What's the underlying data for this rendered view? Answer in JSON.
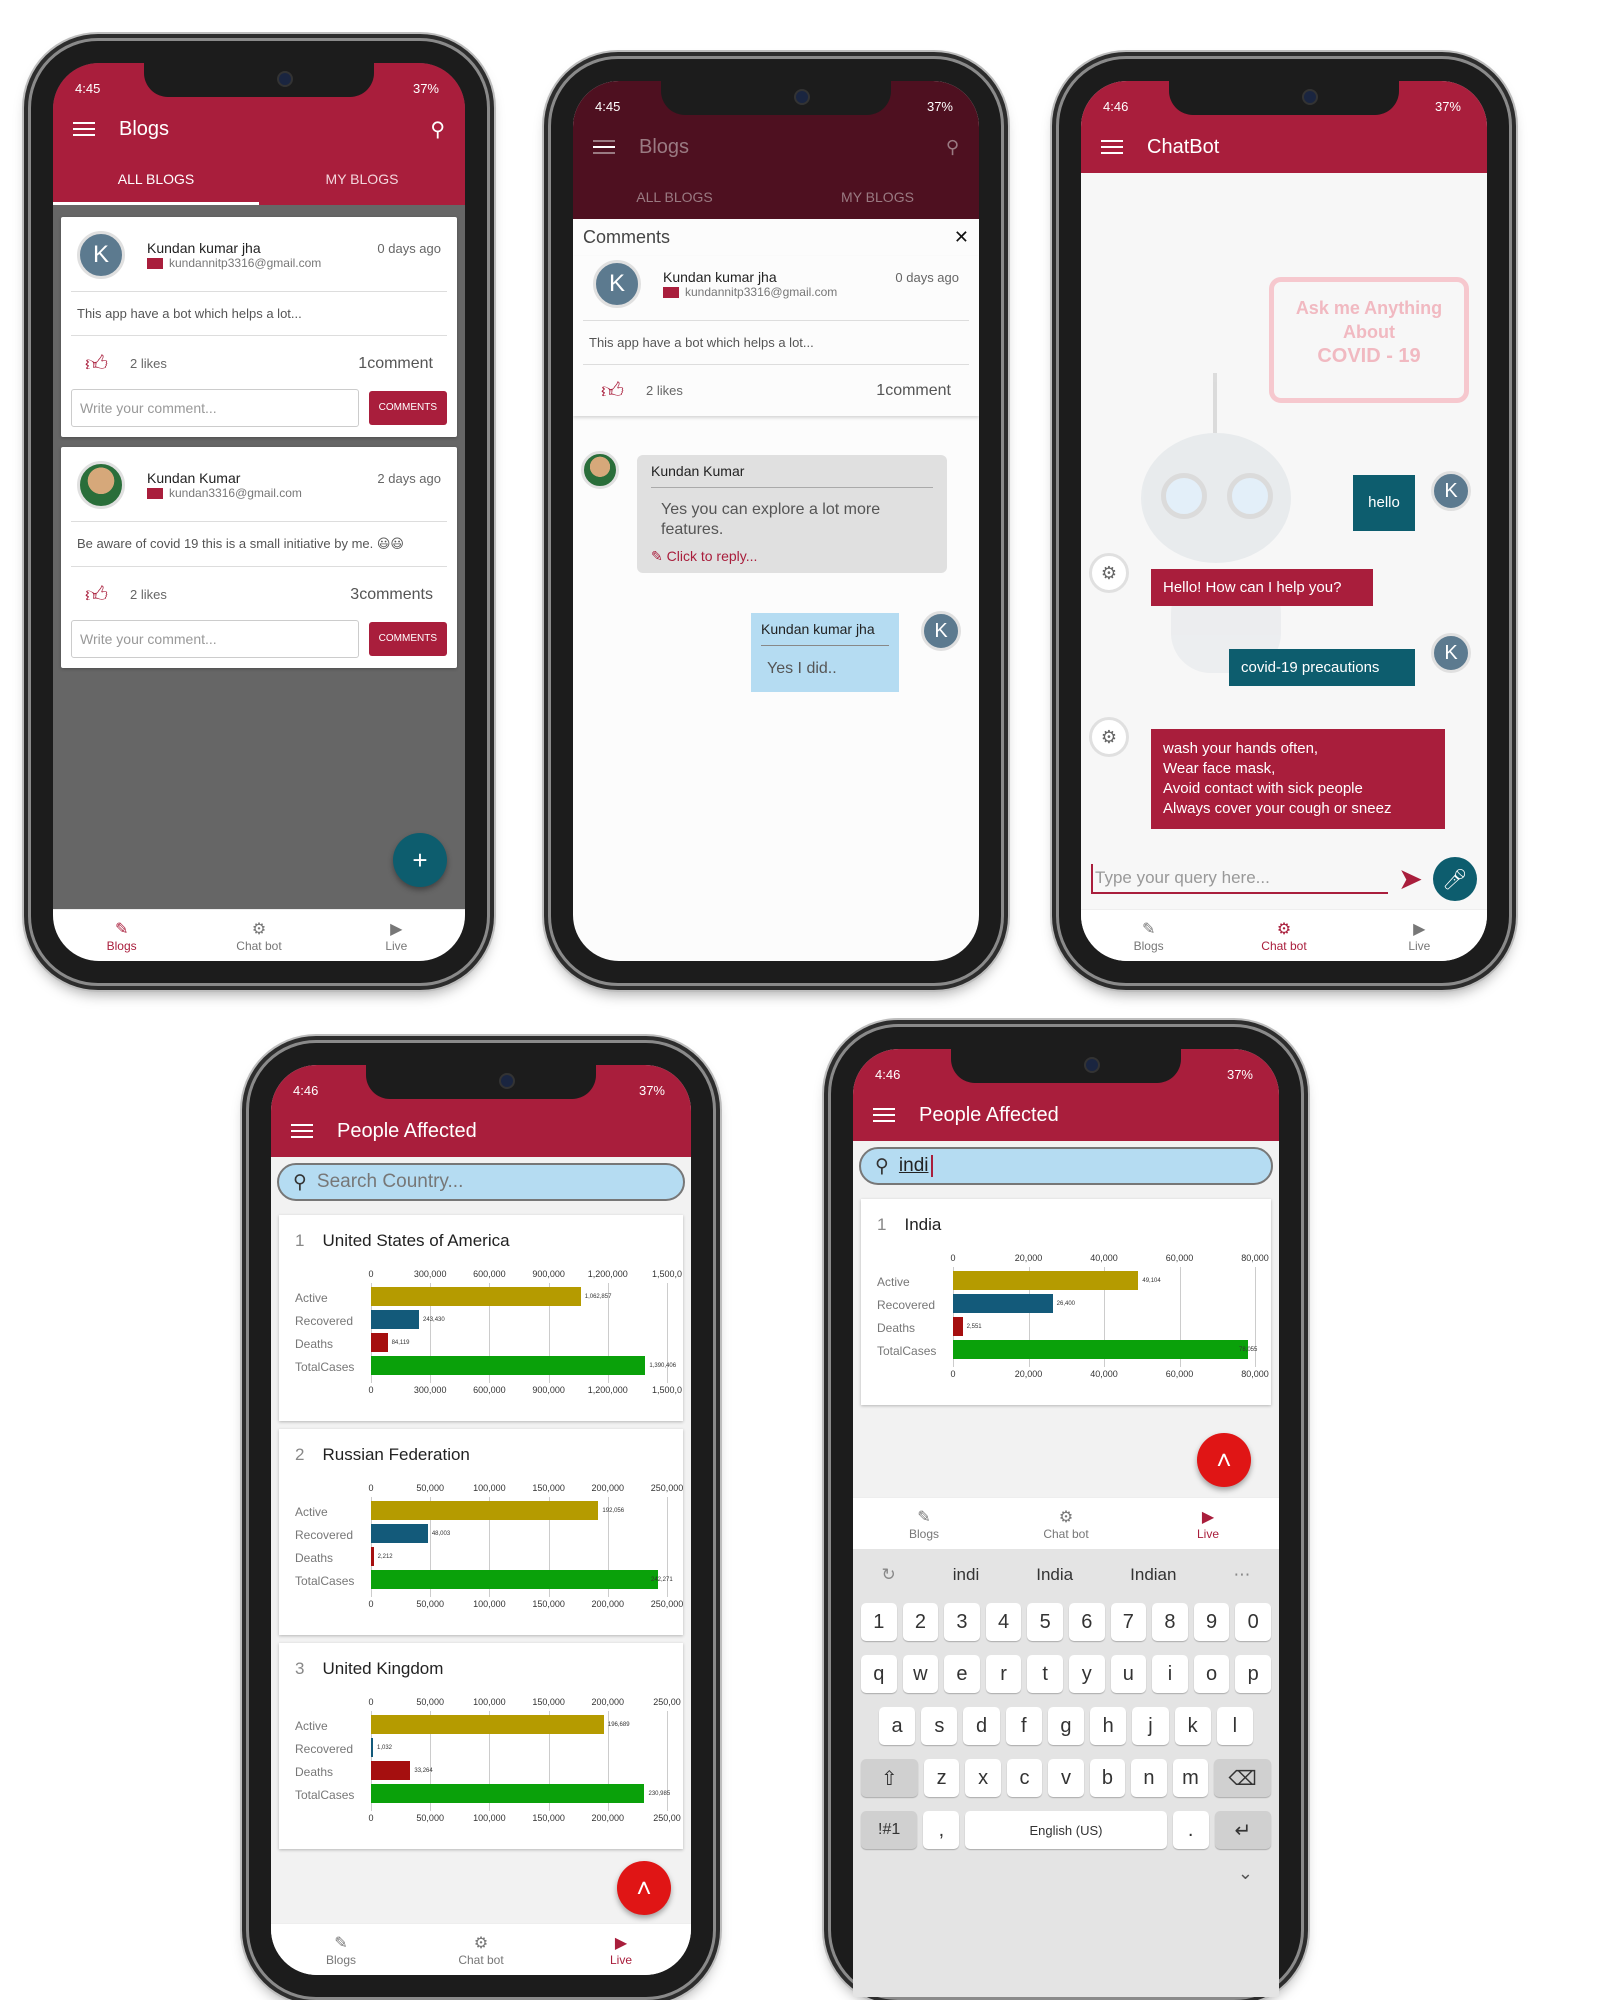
{
  "status": {
    "time1": "4:45",
    "time2": "4:46",
    "battery": "37%"
  },
  "blogs": {
    "title": "Blogs",
    "tabs": [
      "ALL BLOGS",
      "MY BLOGS"
    ],
    "posts": [
      {
        "initial": "K",
        "name": "Kundan kumar jha",
        "email": "kundannitp3316@gmail.com",
        "ago": "0 days ago",
        "body": "This app have a bot which helps a lot...",
        "likes": "2 likes",
        "comments": "1comment"
      },
      {
        "initial": "",
        "name": "Kundan Kumar",
        "email": "kundan3316@gmail.com",
        "ago": "2 days ago",
        "body": "Be aware of covid 19 this is a small initiative by me. 😃😃",
        "likes": "2 likes",
        "comments": "3comments"
      }
    ],
    "comment_placeholder": "Write your comment...",
    "comment_button": "COMMENTS",
    "fab": "+"
  },
  "comments": {
    "title": "Comments",
    "close": "✕",
    "reply1": {
      "name": "Kundan Kumar",
      "text": "Yes you can explore a lot more features.",
      "link": "Click to reply..."
    },
    "reply2": {
      "name": "Kundan kumar jha",
      "text": "Yes I did..",
      "initial": "K"
    }
  },
  "chatbot": {
    "title": "ChatBot",
    "sign": [
      "Ask me Anything",
      "About",
      "COVID - 19"
    ],
    "messages": [
      {
        "from": "user",
        "text": "hello"
      },
      {
        "from": "bot",
        "text": "Hello! How can I help you?"
      },
      {
        "from": "user",
        "text": "covid-19 precautions"
      },
      {
        "from": "bot",
        "lines": [
          "wash your hands often,",
          "Wear face mask,",
          "Avoid contact with sick people",
          "Always cover your cough or sneez"
        ]
      }
    ],
    "user_initial": "K",
    "input_placeholder": "Type your query here..."
  },
  "nav": {
    "blogs": "Blogs",
    "chatbot": "Chat bot",
    "live": "Live"
  },
  "affected": {
    "title": "People Affected",
    "search_placeholder": "Search Country...",
    "search_value": "indi",
    "row_labels": [
      "Active",
      "Recovered",
      "Deaths",
      "TotalCases"
    ],
    "fab": "˄"
  },
  "keyboard": {
    "suggestions": [
      "indi",
      "India",
      "Indian"
    ],
    "numbers": [
      "1",
      "2",
      "3",
      "4",
      "5",
      "6",
      "7",
      "8",
      "9",
      "0"
    ],
    "row1": [
      "q",
      "w",
      "e",
      "r",
      "t",
      "y",
      "u",
      "i",
      "o",
      "p"
    ],
    "row2": [
      "a",
      "s",
      "d",
      "f",
      "g",
      "h",
      "j",
      "k",
      "l"
    ],
    "row3": [
      "z",
      "x",
      "c",
      "v",
      "b",
      "n",
      "m"
    ],
    "sym": "!#1",
    "comma": ",",
    "space": "English (US)",
    "period": "."
  },
  "colors": {
    "primary": "#a91e3c",
    "active": "#b59b00",
    "recovered": "#135a7a",
    "deaths": "#a50f0f",
    "total": "#0aa10a",
    "teal": "#0d5d6e"
  },
  "chart_data": [
    {
      "type": "bar",
      "title": "United States of America",
      "index": "1",
      "categories": [
        "Active",
        "Recovered",
        "Deaths",
        "TotalCases"
      ],
      "values": [
        1062857,
        243430,
        84119,
        1390406
      ],
      "value_labels": [
        "1,062,857",
        "243,430",
        "84,119",
        "1,390,406"
      ],
      "xlim": [
        0,
        1500000
      ],
      "ticks": [
        "0",
        "300,000",
        "600,000",
        "900,000",
        "1,200,000",
        "1,500,0"
      ],
      "grid": true
    },
    {
      "type": "bar",
      "title": "Russian Federation",
      "index": "2",
      "categories": [
        "Active",
        "Recovered",
        "Deaths",
        "TotalCases"
      ],
      "values": [
        192056,
        48003,
        2212,
        242271
      ],
      "value_labels": [
        "192,056",
        "48,003",
        "2,212",
        "242,271"
      ],
      "xlim": [
        0,
        250000
      ],
      "ticks": [
        "0",
        "50,000",
        "100,000",
        "150,000",
        "200,000",
        "250,000"
      ],
      "grid": true
    },
    {
      "type": "bar",
      "title": "United Kingdom",
      "index": "3",
      "categories": [
        "Active",
        "Recovered",
        "Deaths",
        "TotalCases"
      ],
      "values": [
        196689,
        1032,
        33264,
        230985
      ],
      "value_labels": [
        "196,689",
        "1,032",
        "33,264",
        "230,985"
      ],
      "xlim": [
        0,
        250000
      ],
      "ticks": [
        "0",
        "50,000",
        "100,000",
        "150,000",
        "200,000",
        "250,00"
      ],
      "grid": true
    },
    {
      "type": "bar",
      "title": "India",
      "index": "1",
      "categories": [
        "Active",
        "Recovered",
        "Deaths",
        "TotalCases"
      ],
      "values": [
        49104,
        26400,
        2551,
        78055
      ],
      "value_labels": [
        "49,104",
        "26,400",
        "2,551",
        "78,055"
      ],
      "xlim": [
        0,
        80000
      ],
      "ticks": [
        "0",
        "20,000",
        "40,000",
        "60,000",
        "80,000"
      ],
      "grid": true
    }
  ]
}
